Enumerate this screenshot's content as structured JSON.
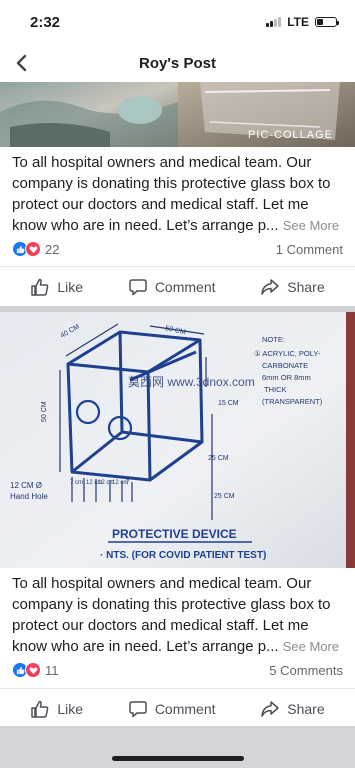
{
  "status_bar": {
    "time": "2:32",
    "network": "LTE"
  },
  "header": {
    "title": "Roy's Post"
  },
  "photo": {
    "watermark": "PIC·COLLAGE"
  },
  "posts": [
    {
      "text": "To all hospital owners and medical team. Our company is donating this protective glass box to protect our doctors and medical staff. Let me know who are in need. Let’s arrange p...",
      "see_more": "See More",
      "reaction_count": "22",
      "comment_count": "1 Comment"
    },
    {
      "text": "To all hospital owners and medical team. Our company is donating this protective glass box to protect our doctors and medical staff. Let me know who are in need. Let’s arrange p...",
      "see_more": "See More",
      "reaction_count": "11",
      "comment_count": "5 Comments"
    }
  ],
  "actions": {
    "like": "Like",
    "comment": "Comment",
    "share": "Share"
  },
  "sketch": {
    "dims": {
      "width": "40 CM",
      "depth": "50 CM",
      "height": "50 CM",
      "upper": "15 CM",
      "lower_1": "25 CM",
      "lower_2": "25 CM"
    },
    "small_dims": [
      "7 cm",
      "12 cm",
      "12 cm",
      "12 cm",
      "7"
    ],
    "hand_hole": [
      "12 CM Ø",
      "Hand Hole"
    ],
    "note_title": "NOTE:",
    "note_lines": [
      "① ACRYLIC, POLY-",
      "CARBONATE",
      "6mm OR 8mm",
      "THICK",
      "(TRANSPARENT)"
    ],
    "caption_1": "PROTECTIVE DEVICE",
    "caption_2": "· NTS. (FOR COVID PATIENT TEST)",
    "watermark": "莫西网 www.3dnox.com"
  }
}
